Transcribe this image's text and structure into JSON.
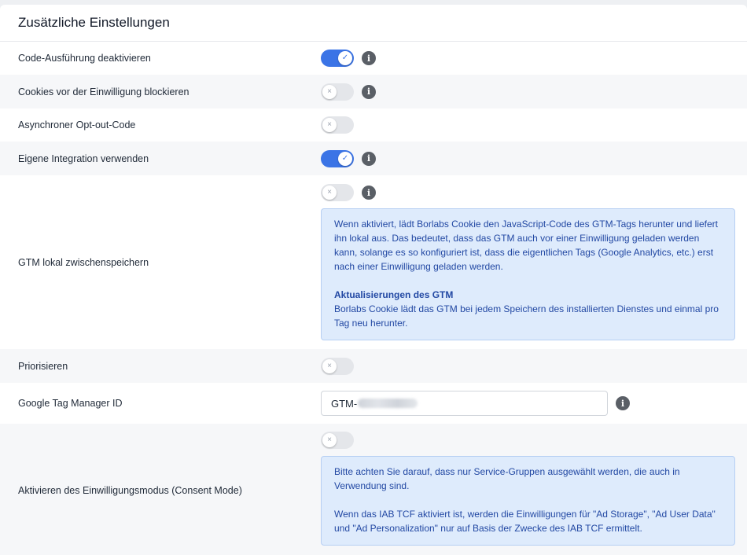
{
  "panel": {
    "title": "Zusätzliche Einstellungen"
  },
  "settings": {
    "code_execution": {
      "label": "Code-Ausführung deaktivieren",
      "enabled": true
    },
    "block_cookies": {
      "label": "Cookies vor der Einwilligung blockieren",
      "enabled": false
    },
    "async_optout": {
      "label": "Asynchroner Opt-out-Code",
      "enabled": false
    },
    "own_integration": {
      "label": "Eigene Integration verwenden",
      "enabled": true
    },
    "gtm_local": {
      "label": "GTM lokal zwischenspeichern",
      "enabled": false,
      "info_p1": "Wenn aktiviert, lädt Borlabs Cookie den JavaScript-Code des GTM-Tags herunter und liefert ihn lokal aus. Das bedeutet, dass das GTM auch vor einer Einwilligung geladen werden kann, solange es so konfiguriert ist, dass die eigentlichen Tags (Google Analytics, etc.) erst nach einer Einwilligung geladen werden.",
      "info_heading": "Aktualisierungen des GTM",
      "info_p2": "Borlabs Cookie lädt das GTM bei jedem Speichern des installierten Dienstes und einmal pro Tag neu herunter."
    },
    "prioritize": {
      "label": "Priorisieren",
      "enabled": false
    },
    "gtm_id": {
      "label": "Google Tag Manager ID",
      "value_prefix": "GTM-"
    },
    "consent_mode": {
      "label": "Aktivieren des Einwilligungsmodus (Consent Mode)",
      "enabled": false,
      "info_p1": "Bitte achten Sie darauf, dass nur Service-Gruppen ausgewählt werden, die auch in Verwendung sind.",
      "info_p2": "Wenn das IAB TCF aktiviert ist, werden die Einwilligungen für \"Ad Storage\", \"Ad User Data\" und \"Ad Personalization\" nur auf Basis der Zwecke des IAB TCF ermittelt."
    }
  },
  "icons": {
    "info": "i",
    "check": "✓",
    "cross": "×"
  },
  "colors": {
    "toggle_on": "#3b74e6",
    "toggle_off": "#e4e6ea",
    "info_box_bg": "#deebfc",
    "info_box_text": "#2248a3"
  }
}
